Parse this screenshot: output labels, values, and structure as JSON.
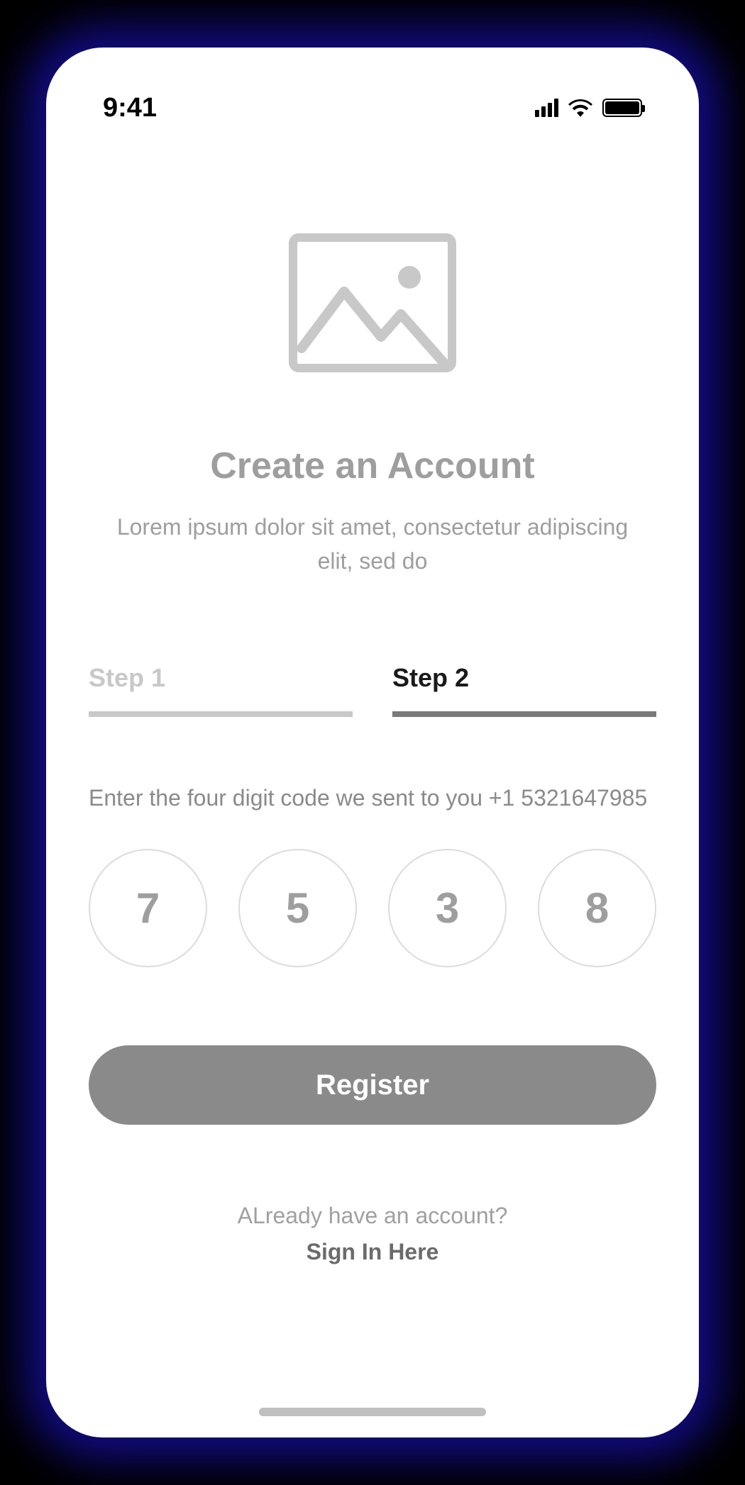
{
  "status": {
    "time": "9:41"
  },
  "header": {
    "title": "Create an Account",
    "subtitle": "Lorem ipsum dolor sit amet, consectetur adipiscing elit, sed do"
  },
  "steps": {
    "step1": "Step 1",
    "step2": "Step 2"
  },
  "form": {
    "instruction": "Enter the four  digit code we sent to you +1 5321647985",
    "code": [
      "7",
      "5",
      "3",
      "8"
    ],
    "register_label": "Register"
  },
  "footer": {
    "prompt": "ALready have an account?",
    "signin": "Sign In Here"
  }
}
